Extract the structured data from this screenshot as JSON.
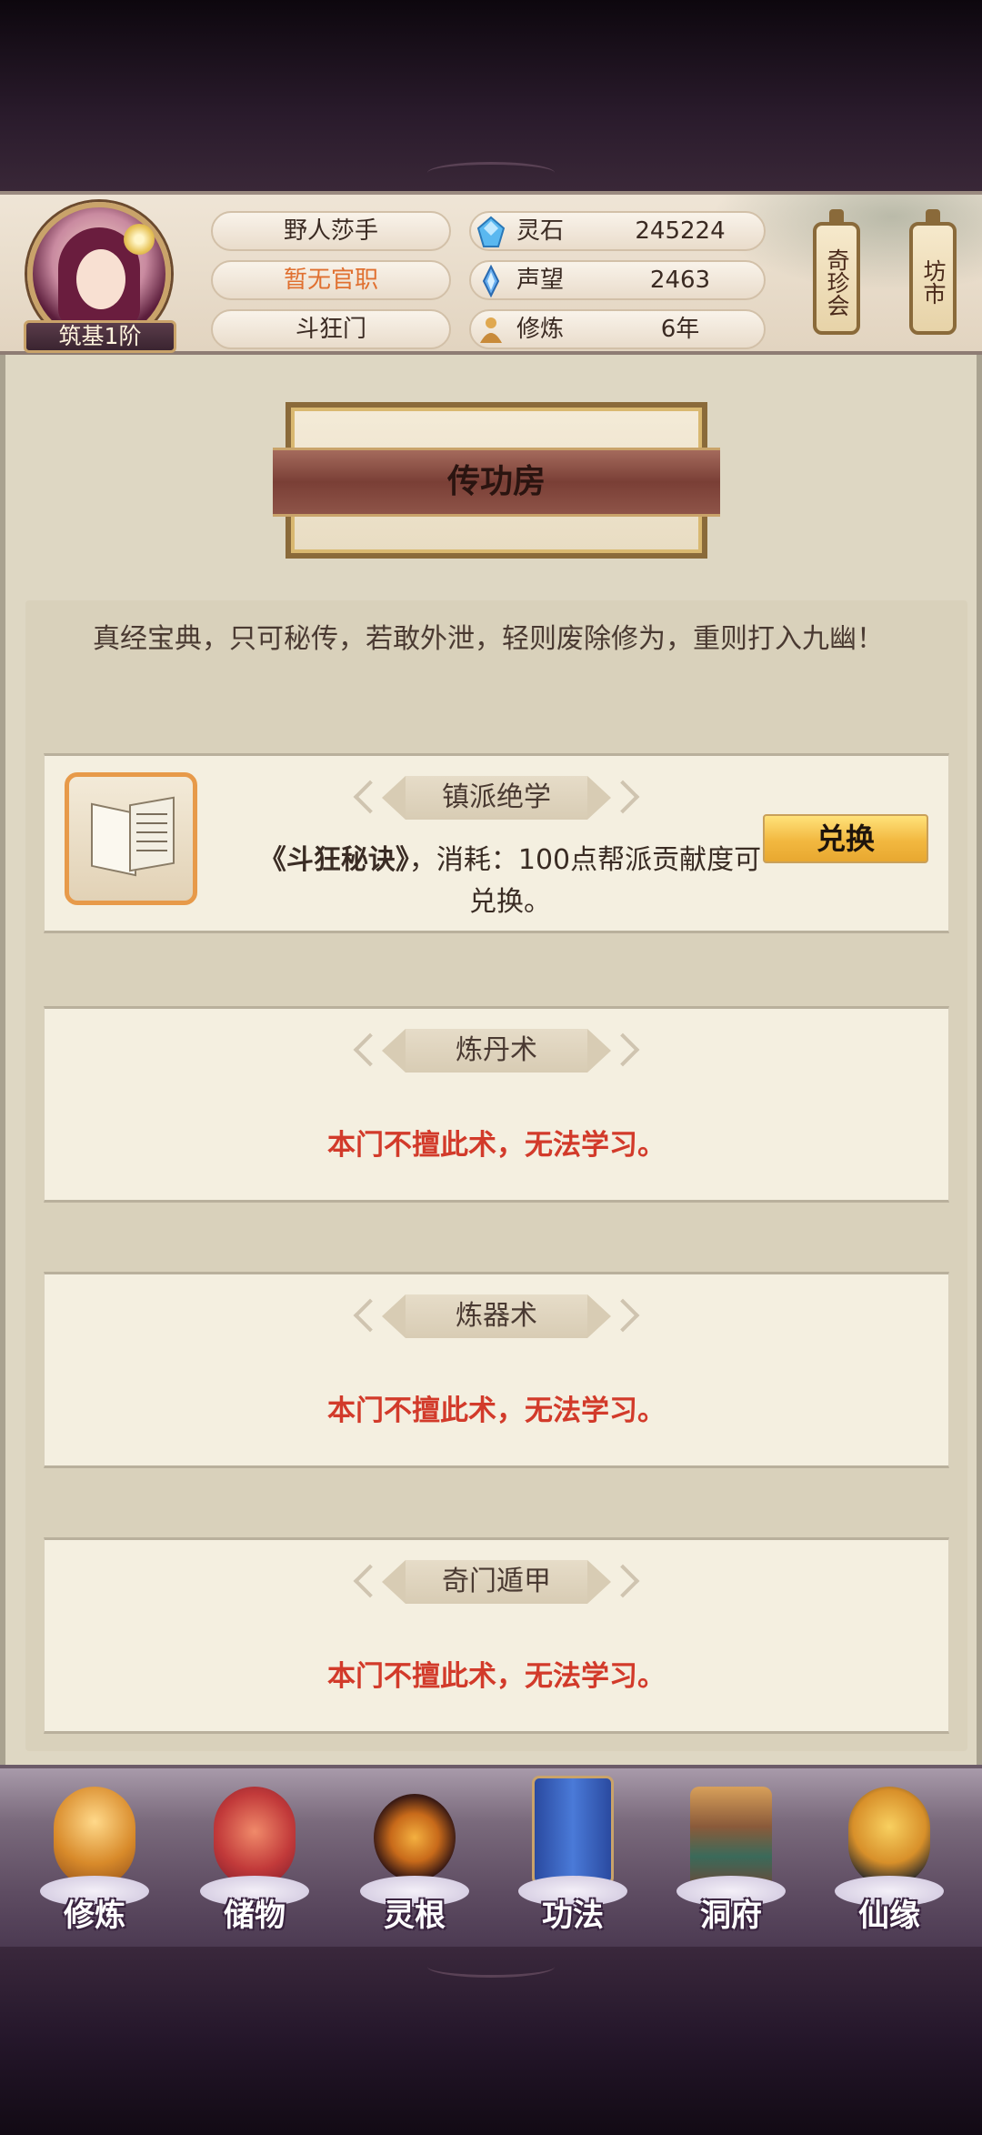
{
  "player": {
    "name": "野人莎手",
    "official_title": "暂无官职",
    "sect": "斗狂门",
    "rank": "筑基1阶"
  },
  "resources": [
    {
      "icon": "spirit-stone-icon",
      "label": "灵石",
      "value": "245224"
    },
    {
      "icon": "reputation-icon",
      "label": "声望",
      "value": "2463"
    },
    {
      "icon": "cultivation-icon",
      "label": "修炼",
      "value": "6年"
    }
  ],
  "top_buttons": {
    "treasure": "奇珍会",
    "market": "坊市"
  },
  "page": {
    "title": "传功房",
    "motto": "真经宝典，只可秘传，若敢外泄，轻则废除修为，重则打入九幽！"
  },
  "cards": [
    {
      "title": "镇派绝学",
      "item_name": "《斗狂秘诀》",
      "item_desc": "，消耗：100点帮派贡献度可兑换。",
      "button": "兑换"
    },
    {
      "title": "炼丹术",
      "message": "本门不擅此术，无法学习。"
    },
    {
      "title": "炼器术",
      "message": "本门不擅此术，无法学习。"
    },
    {
      "title": "奇门遁甲",
      "message": "本门不擅此术，无法学习。"
    }
  ],
  "nav": [
    {
      "icon": "cultivate-icon",
      "label": "修炼"
    },
    {
      "icon": "storage-bag-icon",
      "label": "储物"
    },
    {
      "icon": "spirit-root-icon",
      "label": "灵根"
    },
    {
      "icon": "technique-book-icon",
      "label": "功法"
    },
    {
      "icon": "cave-dwelling-icon",
      "label": "洞府"
    },
    {
      "icon": "immortal-fate-icon",
      "label": "仙缘"
    }
  ],
  "colors": {
    "accent_red": "#d23a2a",
    "accent_orange": "#e07030",
    "button_gold": "#f2b840"
  }
}
